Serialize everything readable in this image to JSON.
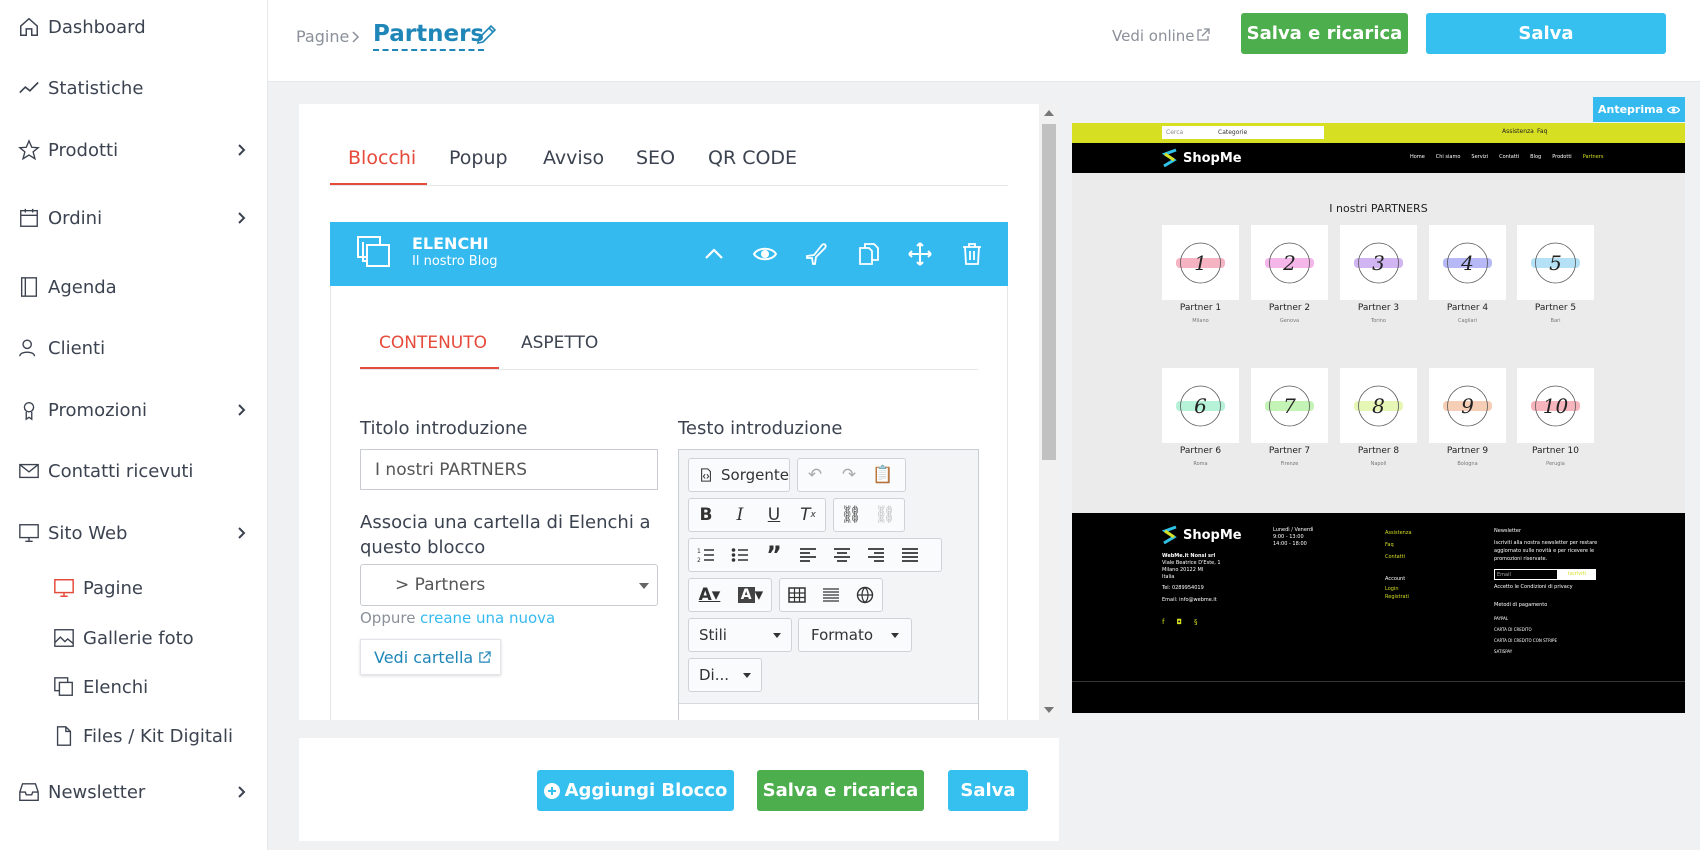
{
  "sidebar": {
    "items": [
      {
        "label": "Dashboard",
        "icon": "home-icon"
      },
      {
        "label": "Statistiche",
        "icon": "trend-icon"
      },
      {
        "label": "Prodotti",
        "icon": "star-icon"
      },
      {
        "label": "Ordini",
        "icon": "calendar-icon"
      },
      {
        "label": "Agenda",
        "icon": "book-icon"
      },
      {
        "label": "Clienti",
        "icon": "users-icon"
      },
      {
        "label": "Promozioni",
        "icon": "pin-icon"
      },
      {
        "label": "Contatti ricevuti",
        "icon": "mail-icon"
      },
      {
        "label": "Sito Web",
        "icon": "monitor-icon"
      },
      {
        "label": "Newsletter",
        "icon": "inbox-icon"
      }
    ],
    "subitems": [
      {
        "label": "Pagine",
        "icon": "monitor-icon"
      },
      {
        "label": "Gallerie foto",
        "icon": "image-icon"
      },
      {
        "label": "Elenchi",
        "icon": "copy-icon"
      },
      {
        "label": "Files / Kit Digitali",
        "icon": "file-icon"
      }
    ]
  },
  "header": {
    "breadcrumb_parent": "Pagine",
    "title": "Partners",
    "view_online": "Vedi online",
    "save_reload": "Salva e ricarica",
    "save": "Salva"
  },
  "tabs": [
    "Blocchi",
    "Popup",
    "Avviso",
    "SEO",
    "QR CODE"
  ],
  "block": {
    "title": "ELENCHI",
    "subtitle": "Il nostro Blog"
  },
  "inner_tabs": [
    "CONTENUTO",
    "ASPETTO"
  ],
  "form": {
    "title_label": "Titolo introduzione",
    "title_value": "I nostri PARTNERS",
    "folder_label": "Associa una cartella di Elenchi a questo blocco",
    "folder_value": "> Partners",
    "or_text": "Oppure",
    "create_link": "creane una nuova",
    "view_folder": "Vedi cartella",
    "text_label": "Testo introduzione"
  },
  "editor_toolbar": {
    "source": "Sorgente",
    "styles": "Stili",
    "format": "Formato",
    "size": "Di..."
  },
  "preview": {
    "badge": "Anteprima",
    "search_placeholder": "Cerca",
    "category": "Categorie",
    "top_links": [
      "Assistenza",
      "Faq"
    ],
    "logo": "ShopMe",
    "menu": [
      "Home",
      "Chi siamo",
      "Servizi",
      "Contatti",
      "Blog",
      "Prodotti",
      "Partners"
    ],
    "section_title": "I nostri PARTNERS",
    "partners": [
      {
        "name": "Partner 1",
        "city": "Milano",
        "num": "1",
        "color": "#f4a7b9"
      },
      {
        "name": "Partner 2",
        "city": "Genova",
        "num": "2",
        "color": "#f3a9e6"
      },
      {
        "name": "Partner 3",
        "city": "Torino",
        "num": "3",
        "color": "#c9a8f0"
      },
      {
        "name": "Partner 4",
        "city": "Cagliari",
        "num": "4",
        "color": "#a9adf3"
      },
      {
        "name": "Partner 5",
        "city": "Bari",
        "num": "5",
        "color": "#a8dcf5"
      },
      {
        "name": "Partner 6",
        "city": "Roma",
        "num": "6",
        "color": "#a8f0d0"
      },
      {
        "name": "Partner 7",
        "city": "Firenze",
        "num": "7",
        "color": "#b9f2a8"
      },
      {
        "name": "Partner 8",
        "city": "Napoli",
        "num": "8",
        "color": "#e0f5a8"
      },
      {
        "name": "Partner 9",
        "city": "Bologna",
        "num": "9",
        "color": "#f5c6a8"
      },
      {
        "name": "Partner 10",
        "city": "Perugia",
        "num": "10",
        "color": "#f5a8b0"
      }
    ],
    "footer": {
      "company": "WebMe.it Nonsi srl",
      "address1": "Viale Beatrice D'Este, 1",
      "address2": "Milano 20122 MI",
      "country": "Italia",
      "tel": "Tel: 0289954019",
      "email": "Email: info@webme.it",
      "hours_title": "Lunedì / Venerdì",
      "hours1": "9:00 - 13:00",
      "hours2": "14:00 - 18:00",
      "links": [
        "Assistenza",
        "Faq",
        "Contatti"
      ],
      "account_title": "Account",
      "account_links": [
        "Login",
        "Registrati"
      ],
      "newsletter_title": "Newsletter",
      "newsletter_text": "Iscriviti alla nostra newsletter per restare aggiornato sulle novità e per ricevere le promozioni riservate.",
      "email_placeholder": "Email",
      "subscribe": "Iscriviti",
      "privacy": "Accetto le Condizioni di privacy",
      "payments_title": "Metodi di pagamento",
      "payments": [
        "PAYPAL",
        "CARTA DI CREDITO",
        "CARTA DI CREDITO CON STRIPE",
        "SATISPAY"
      ]
    }
  },
  "bottom": {
    "add_block": "Aggiungi Blocco",
    "save_reload": "Salva e ricarica",
    "save": "Salva"
  },
  "colors": {
    "accent_red": "#e64a3b",
    "cyan": "#35c0ef",
    "green": "#4cae4c",
    "preview_yellow": "#d6df22"
  }
}
